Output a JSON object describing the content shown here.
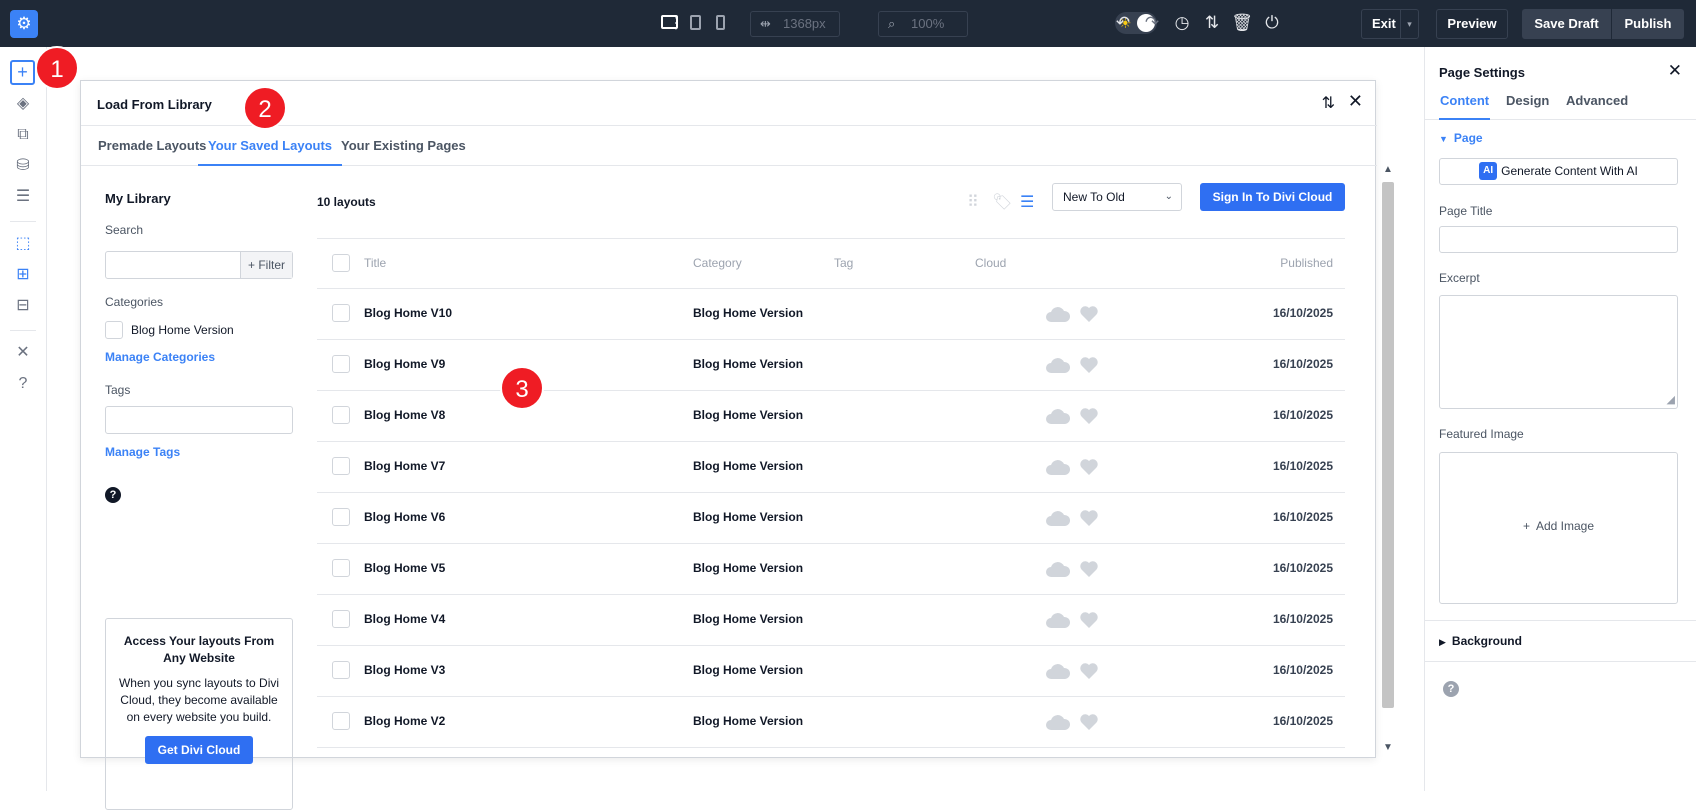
{
  "topbar": {
    "width_value": "1368px",
    "zoom_value": "100%",
    "exit_label": "Exit",
    "preview_label": "Preview",
    "save_draft_label": "Save Draft",
    "publish_label": "Publish"
  },
  "annotations": [
    "1",
    "2",
    "3"
  ],
  "modal": {
    "title": "Load From Library",
    "tabs": [
      "Premade Layouts",
      "Your Saved Layouts",
      "Your Existing Pages"
    ],
    "active_tab": "Your Saved Layouts"
  },
  "library": {
    "heading": "My Library",
    "search_label": "Search",
    "search_value": "",
    "filter_label": "+ Filter",
    "categories_label": "Categories",
    "category_option": "Blog Home Version",
    "manage_categories": "Manage Categories",
    "tags_label": "Tags",
    "tags_value": "",
    "manage_tags": "Manage Tags",
    "help_glyph": "?",
    "promo_title": "Access Your layouts From Any Website",
    "promo_body": "When you sync layouts to Divi Cloud, they become available on every website you build.",
    "promo_button": "Get Divi Cloud"
  },
  "list": {
    "count_label": "10 layouts",
    "sort_value": "New To Old",
    "signin_label": "Sign In To Divi Cloud",
    "columns": [
      "Title",
      "Category",
      "Tag",
      "Cloud",
      "Published"
    ],
    "rows": [
      {
        "title": "Blog Home V10",
        "category": "Blog Home Version",
        "tag": "",
        "published": "16/10/2025"
      },
      {
        "title": "Blog Home V9",
        "category": "Blog Home Version",
        "tag": "",
        "published": "16/10/2025"
      },
      {
        "title": "Blog Home V8",
        "category": "Blog Home Version",
        "tag": "",
        "published": "16/10/2025"
      },
      {
        "title": "Blog Home V7",
        "category": "Blog Home Version",
        "tag": "",
        "published": "16/10/2025"
      },
      {
        "title": "Blog Home V6",
        "category": "Blog Home Version",
        "tag": "",
        "published": "16/10/2025"
      },
      {
        "title": "Blog Home V5",
        "category": "Blog Home Version",
        "tag": "",
        "published": "16/10/2025"
      },
      {
        "title": "Blog Home V4",
        "category": "Blog Home Version",
        "tag": "",
        "published": "16/10/2025"
      },
      {
        "title": "Blog Home V3",
        "category": "Blog Home Version",
        "tag": "",
        "published": "16/10/2025"
      },
      {
        "title": "Blog Home V2",
        "category": "Blog Home Version",
        "tag": "",
        "published": "16/10/2025"
      }
    ]
  },
  "settings": {
    "title": "Page Settings",
    "tabs": [
      "Content",
      "Design",
      "Advanced"
    ],
    "active_tab": "Content",
    "page_section": "Page",
    "ai_logo": "AI",
    "ai_button": "Generate Content With AI",
    "page_title_label": "Page Title",
    "page_title_value": "",
    "excerpt_label": "Excerpt",
    "excerpt_value": "",
    "featured_image_label": "Featured Image",
    "add_image_label": "Add Image",
    "background_section": "Background",
    "help_glyph": "?"
  },
  "colors": {
    "accent": "#3b82f6",
    "button_blue": "#2f6ff2",
    "topbar_bg": "#1f2937",
    "badge_red": "#ef1c24"
  }
}
